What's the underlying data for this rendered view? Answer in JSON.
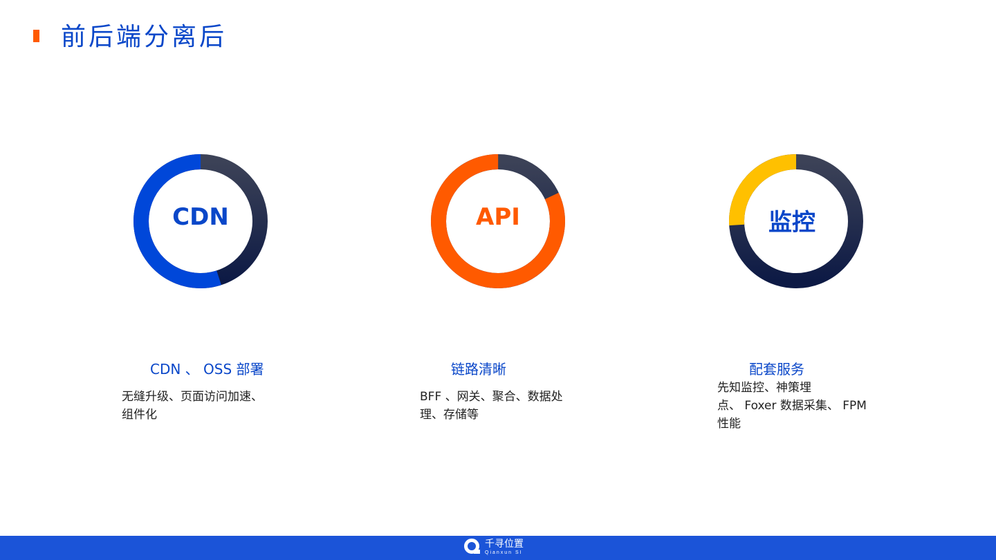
{
  "page": {
    "title": "前后端分离后"
  },
  "colors": {
    "accent_orange": "#ff5a00",
    "brand_blue": "#0a47c9",
    "ring_dark": "#1c2545",
    "ring_yellow": "#ffc000",
    "footer_blue": "#1b54d8"
  },
  "cards": [
    {
      "ring_label": "CDN",
      "ring_color": "#0047d9",
      "label_color": "#0a47c9",
      "highlight_fraction": 0.55,
      "title": "CDN 、 OSS 部署",
      "desc_lines": [
        "无缝升级、页面访问加速、",
        "组件化"
      ]
    },
    {
      "ring_label": "API",
      "ring_color": "#ff5a00",
      "label_color": "#ff5a00",
      "highlight_fraction": 0.82,
      "title": "链路清晰",
      "desc_lines": [
        "BFF 、网关、聚合、数据处",
        "理、存储等"
      ]
    },
    {
      "ring_label": "监控",
      "ring_color": "#ffc000",
      "label_color": "#0a47c9",
      "highlight_fraction": 0.26,
      "title": "配套服务",
      "desc_lines": [
        "先知监控、神策埋",
        "点、 Foxer 数据采集、 FPM",
        "性能"
      ]
    }
  ],
  "footer": {
    "logo_cn": "千寻位置",
    "logo_en": "Qianxun SI"
  }
}
